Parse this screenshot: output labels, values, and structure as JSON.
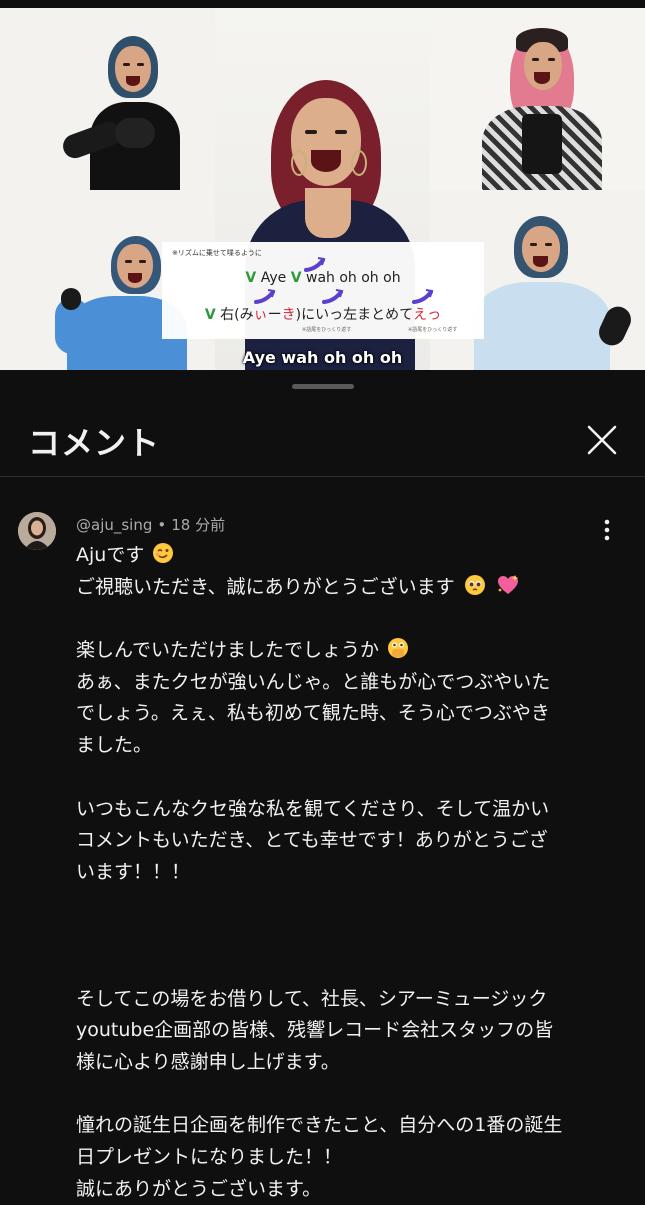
{
  "video": {
    "subtitle_box": {
      "note": "※リズムに乗せて喋るように",
      "line1": {
        "mark1": "V",
        "text1": "Aye",
        "mark2": "V",
        "text2": "wah oh oh oh"
      },
      "line2": {
        "mark": "V",
        "text_a": "右(み",
        "text_red1": "ぃ",
        "text_b": "ー",
        "text_red2": "き",
        "text_c": ")にいっ左まとめて",
        "text_red3": "えっ"
      },
      "tiny_note_1": "※語尾をひっくり返す",
      "tiny_note_2": "※語尾をひっくり返す"
    },
    "caption": "Aye wah oh oh oh"
  },
  "panel": {
    "title": "コメント",
    "close_icon": "close-icon"
  },
  "comment": {
    "author": "@aju_sing",
    "separator": "•",
    "time": "18 分前",
    "menu_icon": "more-vert-icon",
    "lines": {
      "l1": "Ajuです",
      "l2": "ご視聴いただき、誠にありがとうございます",
      "l3": "楽しんでいただけましたでしょうか",
      "l4": "あぁ、またクセが強いんじゃ。と誰もが心でつぶやいた",
      "l5": "でしょう。えぇ、私も初めて観た時、そう心でつぶやき",
      "l6": "ました。",
      "l7": "いつもこんなクセ強な私を観てくださり、そして温かい",
      "l8": "コメントもいただき、とても幸せです！ありがとうござ",
      "l9": "います！！！",
      "l10": "そしてこの場をお借りして、社長、シアーミュージック",
      "l11": "youtube企画部の皆様、残響レコード会社スタッフの皆",
      "l12": "様に心より感謝申し上げます。",
      "l13": "憧れの誕生日企画を制作できたこと、自分への1番の誕生",
      "l14": "日プレゼントになりました！！",
      "l15": "誠にありがとうございます。"
    },
    "emojis": [
      "winking-face-emoji",
      "pleading-face-emoji",
      "sparkling-heart-emoji",
      "face-with-open-eyes-and-hand-over-mouth-emoji"
    ]
  },
  "colors": {
    "background": "#0f0f0f",
    "text": "#f1f1f1",
    "meta": "#aaaaaa",
    "subtitle_green": "#2d9a3a",
    "subtitle_red": "#d8263a"
  }
}
